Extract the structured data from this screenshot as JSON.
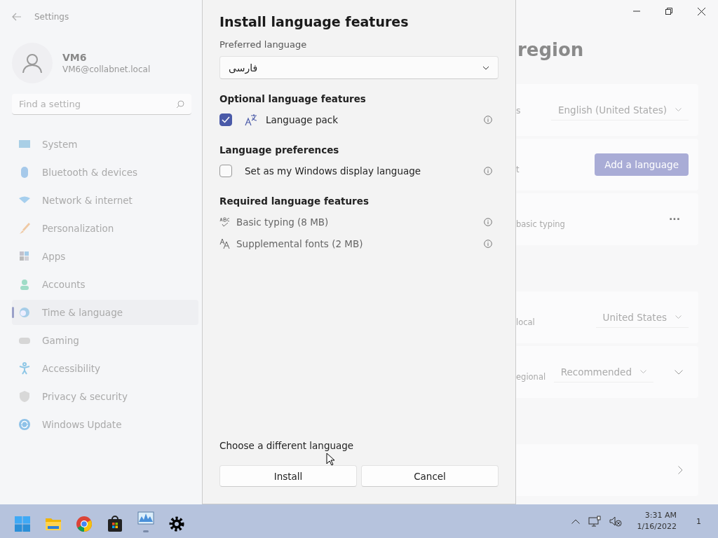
{
  "window": {
    "title": "Settings"
  },
  "account": {
    "name": "VM6",
    "email": "VM6@collabnet.local"
  },
  "search": {
    "placeholder": "Find a setting"
  },
  "nav": [
    {
      "label": "System",
      "selected": false
    },
    {
      "label": "Bluetooth & devices",
      "selected": false
    },
    {
      "label": "Network & internet",
      "selected": false
    },
    {
      "label": "Personalization",
      "selected": false
    },
    {
      "label": "Apps",
      "selected": false
    },
    {
      "label": "Accounts",
      "selected": false
    },
    {
      "label": "Time & language",
      "selected": true
    },
    {
      "label": "Gaming",
      "selected": false
    },
    {
      "label": "Accessibility",
      "selected": false
    },
    {
      "label": "Privacy & security",
      "selected": false
    },
    {
      "label": "Windows Update",
      "selected": false
    }
  ],
  "page": {
    "title": "region",
    "groups": [
      [
        {
          "kind": "dropdown",
          "label": "s",
          "value": "English (United States)"
        },
        {
          "kind": "button",
          "label": "t",
          "value": "Add a language"
        },
        {
          "kind": "more",
          "label": "basic typing",
          "value": "···"
        }
      ],
      [
        {
          "kind": "dropdown",
          "label": "local",
          "value": "United States"
        },
        {
          "kind": "expand",
          "label": "egional",
          "value": "Recommended"
        }
      ],
      [
        {
          "kind": "chevron"
        }
      ]
    ]
  },
  "dialog": {
    "title": "Install language features",
    "preferred_label": "Preferred language",
    "preferred_value": "فارسی",
    "sections": [
      {
        "heading": "Optional language features",
        "items": [
          {
            "kind": "pack",
            "label": "Language pack",
            "checked": true
          }
        ]
      },
      {
        "heading": "Language preferences",
        "items": [
          {
            "kind": "checkbox",
            "label": "Set as my Windows display language",
            "checked": false
          }
        ]
      },
      {
        "heading": "Required language features",
        "items": [
          {
            "kind": "feature",
            "label": "Basic typing (8 MB)"
          },
          {
            "kind": "feature",
            "label": "Supplemental fonts (2 MB)"
          }
        ]
      }
    ],
    "link": "Choose a different language",
    "buttons": [
      "Install",
      "Cancel"
    ]
  },
  "taskbar": {
    "apps": [
      {
        "running": false
      },
      {
        "running": false
      },
      {
        "running": false
      },
      {
        "running": false
      },
      {
        "running": true
      },
      {
        "running": false
      }
    ],
    "time": "3:31 AM",
    "date": "1/16/2022",
    "notifications": "1"
  }
}
